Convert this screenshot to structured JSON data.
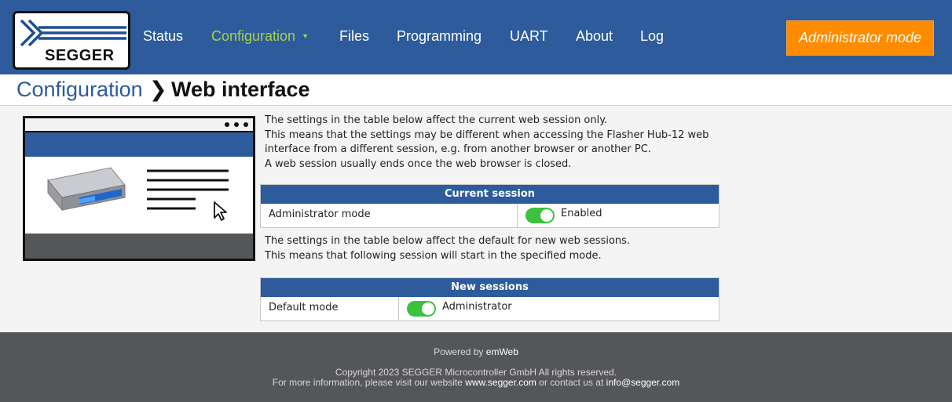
{
  "header": {
    "logo_text": "SEGGER",
    "nav": [
      {
        "label": "Status"
      },
      {
        "label": "Configuration",
        "active": true
      },
      {
        "label": "Files"
      },
      {
        "label": "Programming"
      },
      {
        "label": "UART"
      },
      {
        "label": "About"
      },
      {
        "label": "Log"
      }
    ],
    "admin_button": "Administrator mode"
  },
  "breadcrumb": {
    "root": "Configuration",
    "separator": "❯",
    "current": "Web interface"
  },
  "intro": {
    "lines": [
      "The settings in the table below affect the current web session only.",
      "This means that the settings may be different when accessing the Flasher Hub-12 web",
      "interface from a different session, e.g. from another browser or another PC.",
      "A web session usually ends once the web browser is closed."
    ]
  },
  "current_session": {
    "title": "Current session",
    "row_label": "Administrator mode",
    "value": "Enabled",
    "enabled": true
  },
  "new_info": {
    "lines": [
      "The settings in the table below affect the default for new web sessions.",
      "This means that following session will start in the specified mode."
    ]
  },
  "new_sessions": {
    "title": "New sessions",
    "row_label": "Default mode",
    "value": "Administrator",
    "enabled": true
  },
  "footer": {
    "powered_prefix": "Powered by",
    "powered_name": "emWeb",
    "copyright": "Copyright 2023 SEGGER Microcontroller GmbH All rights reserved.",
    "info_prefix": "For more information, please visit our website",
    "website": "www.segger.com",
    "info_middle": "or contact us at",
    "email": "info@segger.com"
  },
  "colors": {
    "header_bg": "#2d5b9c",
    "nav_active": "#a8d24a",
    "admin_button_bg": "#ff8c00",
    "toggle_on": "#3cc13c",
    "footer_bg": "#555659"
  }
}
